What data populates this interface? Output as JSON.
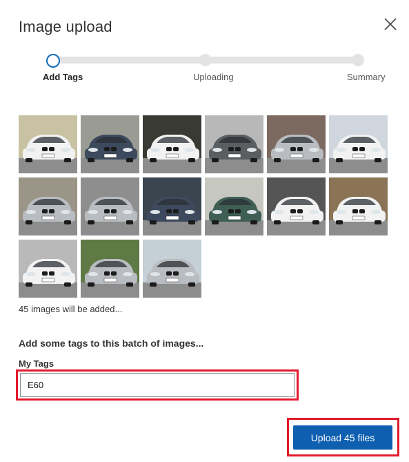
{
  "dialog": {
    "title": "Image upload",
    "close_icon": "close-icon"
  },
  "stepper": {
    "steps": [
      {
        "label": "Add Tags",
        "state": "active"
      },
      {
        "label": "Uploading",
        "state": "pending"
      },
      {
        "label": "Summary",
        "state": "pending"
      }
    ],
    "active_color": "#0f6cbd",
    "track_color": "#e3e3e3"
  },
  "thumbnails": {
    "shown_count": 15,
    "items": [
      {
        "car": "white sedan",
        "bg": "#c9c2a2"
      },
      {
        "car": "dark blue sedan",
        "bg": "#9a9c93"
      },
      {
        "car": "white sedan",
        "bg": "#3a3a34"
      },
      {
        "car": "dark grey sedan",
        "bg": "#b8b8b8"
      },
      {
        "car": "silver sedan",
        "bg": "#7c6a60"
      },
      {
        "car": "white sedan",
        "bg": "#cfd6dd"
      },
      {
        "car": "silver sedan",
        "bg": "#9a9586"
      },
      {
        "car": "silver sedan",
        "bg": "#8e8e8e"
      },
      {
        "car": "dark blue sedan",
        "bg": "#3a4550"
      },
      {
        "car": "dark green sedan",
        "bg": "#c6c8c0"
      },
      {
        "car": "white sedan",
        "bg": "#555555"
      },
      {
        "car": "white sedan",
        "bg": "#8b7355"
      },
      {
        "car": "white sedan",
        "bg": "#b9b9b9"
      },
      {
        "car": "silver sedan",
        "bg": "#5f7a45"
      },
      {
        "car": "silver sedan",
        "bg": "#c4cfd6"
      }
    ]
  },
  "status": {
    "count_text": "45 images will be added..."
  },
  "tags": {
    "heading": "Add some tags to this batch of images...",
    "label": "My Tags",
    "value": "E60"
  },
  "actions": {
    "upload_label": "Upload 45 files",
    "upload_color": "#0f5fb0"
  },
  "highlight_color": "#e3192a"
}
